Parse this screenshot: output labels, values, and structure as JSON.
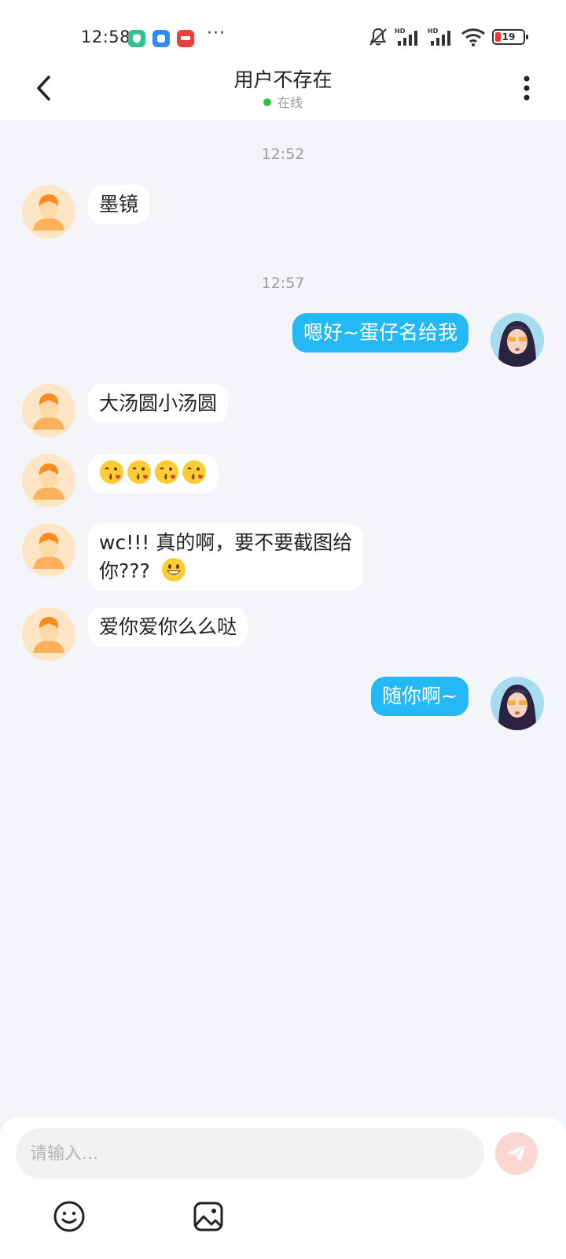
{
  "status_bar": {
    "time": "12:58",
    "more": "···",
    "hd_label": "HD",
    "battery_level": "19"
  },
  "header": {
    "title": "用户不存在",
    "status": "在线"
  },
  "messages": [
    {
      "type": "timestamp",
      "text": "12:52"
    },
    {
      "type": "received",
      "text": "墨镜"
    },
    {
      "type": "timestamp",
      "text": "12:57"
    },
    {
      "type": "sent",
      "text": "嗯好~蛋仔名给我"
    },
    {
      "type": "received",
      "text": "大汤圆小汤圆"
    },
    {
      "type": "received",
      "emoji": [
        "face-blowing-kiss-icon",
        "face-blowing-kiss-icon",
        "face-blowing-kiss-icon",
        "face-blowing-kiss-icon"
      ]
    },
    {
      "type": "received",
      "line1": "wc!!! 真的啊，要不要截图给",
      "line2": "你???",
      "emoji": "grinning-face-icon"
    },
    {
      "type": "received",
      "text": "爱你爱你么么哒"
    },
    {
      "type": "sent",
      "text": "随你啊~"
    }
  ],
  "composer": {
    "placeholder": "请输入..."
  },
  "colors": {
    "sent_bubble": "#25b8f6",
    "received_bubble": "#ffffff",
    "background": "#f4f5f8",
    "online": "#27c840",
    "send_button": "#fbd7d2"
  }
}
